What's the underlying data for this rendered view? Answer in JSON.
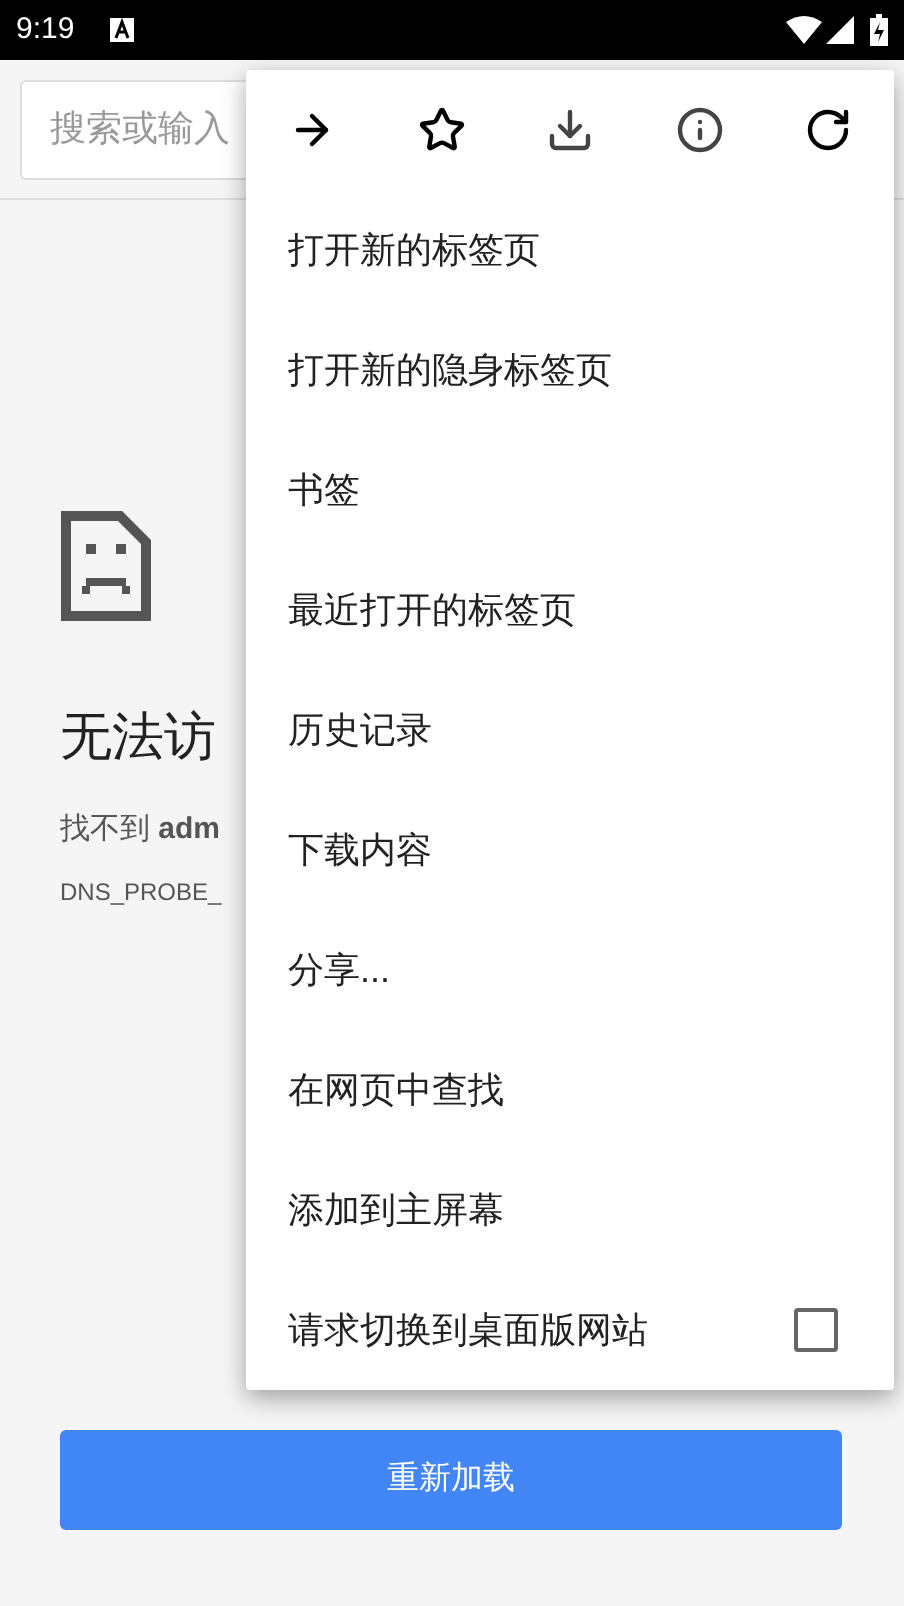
{
  "status_bar": {
    "time": "9:19"
  },
  "search": {
    "placeholder": "搜索或输入"
  },
  "error": {
    "title": "无法访",
    "message": "找不到 **adm**",
    "code": "DNS_PROBE_"
  },
  "reload_button": "重新加载",
  "menu": {
    "icons": [
      {
        "kind": "forward"
      },
      {
        "kind": "star"
      },
      {
        "kind": "download"
      },
      {
        "kind": "info"
      },
      {
        "kind": "refresh"
      }
    ],
    "items": [
      {
        "kind": "item",
        "label": "打开新的标签页"
      },
      {
        "kind": "item",
        "label": "打开新的隐身标签页"
      },
      {
        "kind": "item",
        "label": "书签"
      },
      {
        "kind": "item",
        "label": "最近打开的标签页"
      },
      {
        "kind": "item",
        "label": "历史记录"
      },
      {
        "kind": "item",
        "label": "下载内容"
      },
      {
        "kind": "item",
        "label": "分享..."
      },
      {
        "kind": "item",
        "label": "在网页中查找"
      },
      {
        "kind": "item",
        "label": "添加到主屏幕"
      },
      {
        "kind": "checkbox",
        "label": "请求切换到桌面版网站",
        "checked": false
      }
    ]
  }
}
